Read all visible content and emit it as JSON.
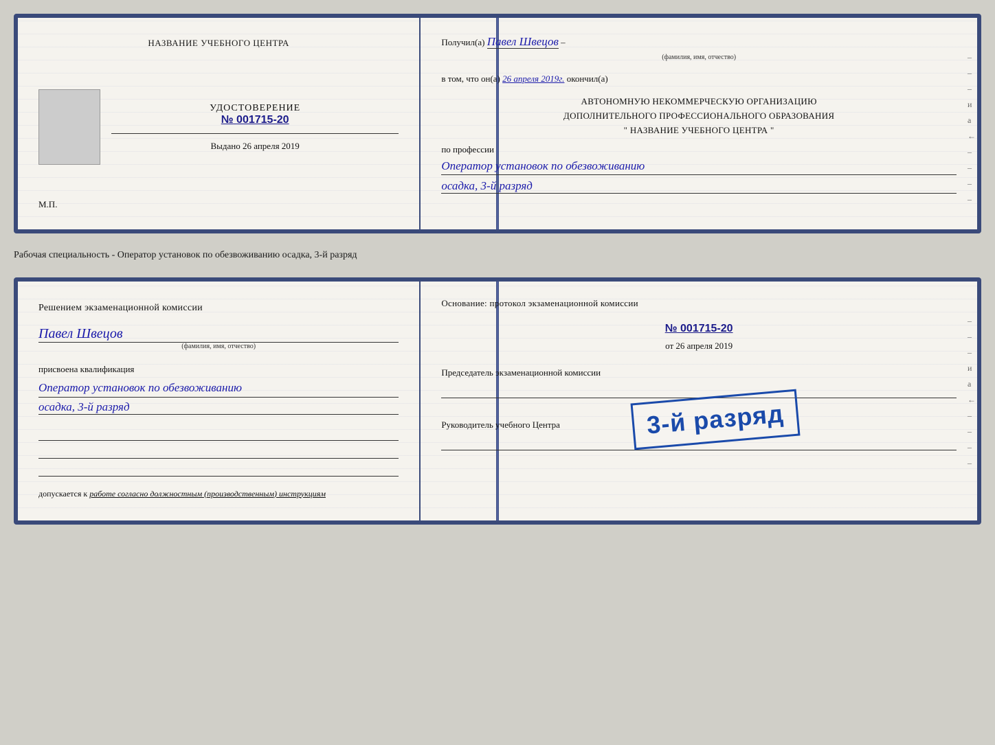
{
  "page": {
    "background_color": "#d0cfc8"
  },
  "cert_top": {
    "left": {
      "title": "НАЗВАНИЕ УЧЕБНОГО ЦЕНТРА",
      "udostoverenie_label": "УДОСТОВЕРЕНИЕ",
      "number_prefix": "№",
      "number": "001715-20",
      "vydano_label": "Выдано",
      "vydano_date": "26 апреля 2019",
      "mp_label": "М.П."
    },
    "right": {
      "poluchil_label": "Получил(а)",
      "recipient_name": "Павел Швецов",
      "name_sublabel": "(фамилия, имя, отчество)",
      "dash": "–",
      "v_tom_label": "в том, что он(а)",
      "date_value": "26 апреля 2019г.",
      "okonchil_label": "окончил(а)",
      "autonomous_line1": "АВТОНОМНУЮ НЕКОММЕРЧЕСКУЮ ОРГАНИЗАЦИЮ",
      "autonomous_line2": "ДОПОЛНИТЕЛЬНОГО ПРОФЕССИОНАЛЬНОГО ОБРАЗОВАНИЯ",
      "autonomous_line3": "\"    НАЗВАНИЕ УЧЕБНОГО ЦЕНТРА    \"",
      "po_professii_label": "по профессии",
      "profession_value": "Оператор установок по обезвоживанию",
      "razryad_value": "осадка, 3-й разряд"
    }
  },
  "separator": {
    "text": "Рабочая специальность - Оператор установок по обезвоживанию осадка, 3-й разряд"
  },
  "cert_bottom": {
    "left": {
      "resheniem_label": "Решением экзаменационной комиссии",
      "name": "Павел Швецов",
      "name_sublabel": "(фамилия, имя, отчество)",
      "prisvoena_label": "присвоена квалификация",
      "qualification_line1": "Оператор установок по обезвоживанию",
      "qualification_line2": "осадка, 3-й разряд",
      "dopuskaetsya_prefix": "допускается к",
      "dopuskaetsya_value": "работе согласно должностным (производственным) инструкциям"
    },
    "right": {
      "osnovanie_label": "Основание: протокол экзаменационной комиссии",
      "number_prefix": "№",
      "number": "001715-20",
      "ot_label": "от",
      "date": "26 апреля 2019",
      "predsedatel_label": "Председатель экзаменационной комиссии",
      "rukovoditel_label": "Руководитель учебного Центра"
    },
    "stamp": {
      "text": "3-й разряд"
    }
  },
  "side_decorations": {
    "right_letters": [
      "–",
      "–",
      "–",
      "и",
      "а",
      "←",
      "–",
      "–",
      "–",
      "–"
    ]
  }
}
